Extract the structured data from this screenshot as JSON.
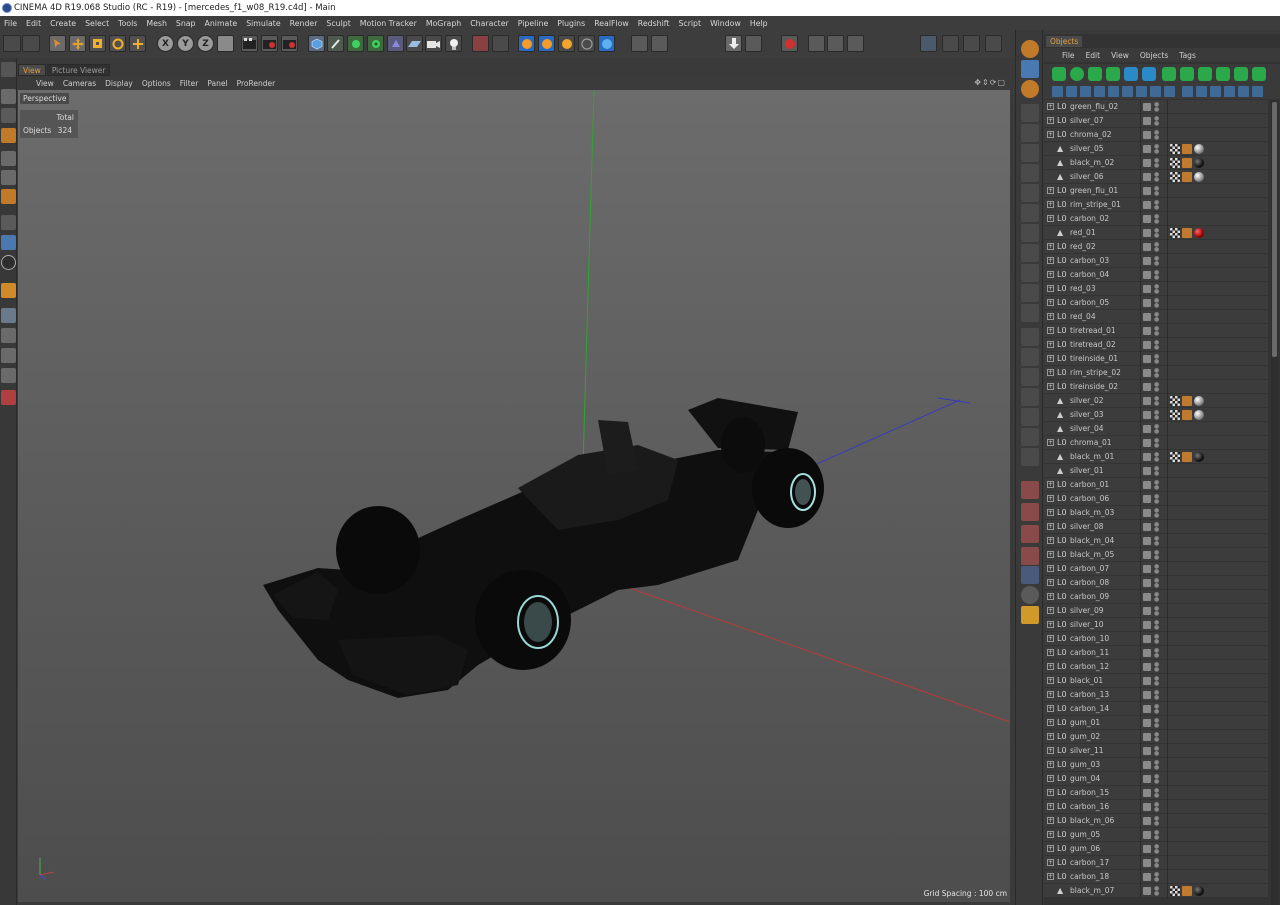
{
  "window": {
    "title": "CINEMA 4D R19.068 Studio (RC - R19) - [mercedes_f1_w08_R19.c4d] - Main"
  },
  "menu": [
    "File",
    "Edit",
    "Create",
    "Select",
    "Tools",
    "Mesh",
    "Snap",
    "Animate",
    "Simulate",
    "Render",
    "Sculpt",
    "Motion Tracker",
    "MoGraph",
    "Character",
    "Pipeline",
    "Plugins",
    "RealFlow",
    "Redshift",
    "Script",
    "Window",
    "Help"
  ],
  "toolbar": {
    "axis_x": "X",
    "axis_y": "Y",
    "axis_z": "Z"
  },
  "viewport_tabs": [
    "View",
    "Picture Viewer"
  ],
  "viewport_menu": [
    "View",
    "Cameras",
    "Display",
    "Options",
    "Filter",
    "Panel",
    "ProRender"
  ],
  "viewport": {
    "camera_label": "Perspective",
    "stats_header": "Total",
    "stats_label": "Objects",
    "stats_value": "324",
    "grid_spacing": "Grid Spacing : 100 cm"
  },
  "objects_panel": {
    "tab": "Objects",
    "menu": [
      "File",
      "Edit",
      "View",
      "Objects",
      "Tags"
    ],
    "rows": [
      {
        "name": "green_flu_02",
        "type": "null",
        "tags": []
      },
      {
        "name": "silver_07",
        "type": "null",
        "tags": []
      },
      {
        "name": "chroma_02",
        "type": "null",
        "tags": []
      },
      {
        "name": "silver_05",
        "type": "poly",
        "tags": [
          "chk",
          "mat",
          "ball-white"
        ]
      },
      {
        "name": "black_m_02",
        "type": "poly",
        "tags": [
          "chk",
          "mat",
          "ball-black"
        ]
      },
      {
        "name": "silver_06",
        "type": "poly",
        "tags": [
          "chk",
          "mat",
          "ball-white"
        ]
      },
      {
        "name": "green_flu_01",
        "type": "null",
        "tags": []
      },
      {
        "name": "rim_stripe_01",
        "type": "null",
        "tags": []
      },
      {
        "name": "carbon_02",
        "type": "null",
        "tags": []
      },
      {
        "name": "red_01",
        "type": "poly",
        "tags": [
          "chk",
          "mat",
          "ball-red"
        ]
      },
      {
        "name": "red_02",
        "type": "null",
        "tags": []
      },
      {
        "name": "carbon_03",
        "type": "null",
        "tags": []
      },
      {
        "name": "carbon_04",
        "type": "null",
        "tags": []
      },
      {
        "name": "red_03",
        "type": "null",
        "tags": []
      },
      {
        "name": "carbon_05",
        "type": "null",
        "tags": []
      },
      {
        "name": "red_04",
        "type": "null",
        "tags": []
      },
      {
        "name": "tiretread_01",
        "type": "null",
        "tags": []
      },
      {
        "name": "tiretread_02",
        "type": "null",
        "tags": []
      },
      {
        "name": "tireinside_01",
        "type": "null",
        "tags": []
      },
      {
        "name": "rim_stripe_02",
        "type": "null",
        "tags": []
      },
      {
        "name": "tireinside_02",
        "type": "null",
        "tags": []
      },
      {
        "name": "silver_02",
        "type": "poly",
        "tags": [
          "chk",
          "mat",
          "ball-white"
        ]
      },
      {
        "name": "silver_03",
        "type": "poly",
        "tags": [
          "chk",
          "mat",
          "ball-white"
        ]
      },
      {
        "name": "silver_04",
        "type": "poly",
        "tags": []
      },
      {
        "name": "chroma_01",
        "type": "null",
        "tags": []
      },
      {
        "name": "black_m_01",
        "type": "poly",
        "tags": [
          "chk",
          "mat",
          "ball-black"
        ]
      },
      {
        "name": "silver_01",
        "type": "poly",
        "tags": []
      },
      {
        "name": "carbon_01",
        "type": "null",
        "tags": []
      },
      {
        "name": "carbon_06",
        "type": "null",
        "tags": []
      },
      {
        "name": "black_m_03",
        "type": "null",
        "tags": []
      },
      {
        "name": "silver_08",
        "type": "null",
        "tags": []
      },
      {
        "name": "black_m_04",
        "type": "null",
        "tags": []
      },
      {
        "name": "black_m_05",
        "type": "null",
        "tags": []
      },
      {
        "name": "carbon_07",
        "type": "null",
        "tags": []
      },
      {
        "name": "carbon_08",
        "type": "null",
        "tags": []
      },
      {
        "name": "carbon_09",
        "type": "null",
        "tags": []
      },
      {
        "name": "silver_09",
        "type": "null",
        "tags": []
      },
      {
        "name": "silver_10",
        "type": "null",
        "tags": []
      },
      {
        "name": "carbon_10",
        "type": "null",
        "tags": []
      },
      {
        "name": "carbon_11",
        "type": "null",
        "tags": []
      },
      {
        "name": "carbon_12",
        "type": "null",
        "tags": []
      },
      {
        "name": "black_01",
        "type": "null",
        "tags": []
      },
      {
        "name": "carbon_13",
        "type": "null",
        "tags": []
      },
      {
        "name": "carbon_14",
        "type": "null",
        "tags": []
      },
      {
        "name": "gum_01",
        "type": "null",
        "tags": []
      },
      {
        "name": "gum_02",
        "type": "null",
        "tags": []
      },
      {
        "name": "silver_11",
        "type": "null",
        "tags": []
      },
      {
        "name": "gum_03",
        "type": "null",
        "tags": []
      },
      {
        "name": "gum_04",
        "type": "null",
        "tags": []
      },
      {
        "name": "carbon_15",
        "type": "null",
        "tags": []
      },
      {
        "name": "carbon_16",
        "type": "null",
        "tags": []
      },
      {
        "name": "black_m_06",
        "type": "null",
        "tags": []
      },
      {
        "name": "gum_05",
        "type": "null",
        "tags": []
      },
      {
        "name": "gum_06",
        "type": "null",
        "tags": []
      },
      {
        "name": "carbon_17",
        "type": "null",
        "tags": []
      },
      {
        "name": "carbon_18",
        "type": "null",
        "tags": []
      },
      {
        "name": "black_m_07",
        "type": "poly",
        "tags": [
          "chk",
          "mat",
          "ball-black"
        ]
      }
    ]
  },
  "colors": {
    "accent": "#e09a3a",
    "viewport_bg": "#636363",
    "axis_x": "#c03030",
    "axis_y": "#30b030",
    "axis_z": "#3040c0"
  }
}
